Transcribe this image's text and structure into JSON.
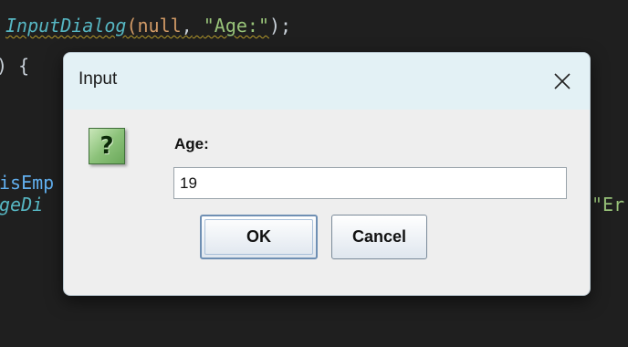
{
  "editor": {
    "line1": {
      "method": "InputDialog",
      "open_paren": "(",
      "null_kw": "null",
      "comma": ",",
      "string": "\"Age:\"",
      "close": ");"
    },
    "line2": ") {",
    "line3": "isEmp",
    "line4_method": "geDi",
    "line4_string": "\"Er"
  },
  "dialog": {
    "title": "Input",
    "close_icon": "close-x-icon",
    "question_icon": "question-icon",
    "question_glyph": "?",
    "prompt": "Age:",
    "input_value": "19",
    "ok_label": "OK",
    "cancel_label": "Cancel"
  },
  "colors": {
    "titlebar": "#e3f1f5",
    "dialog_bg": "#eeeeee",
    "editor_bg": "#1f1f1f",
    "icon_green": "#8cc27a"
  }
}
